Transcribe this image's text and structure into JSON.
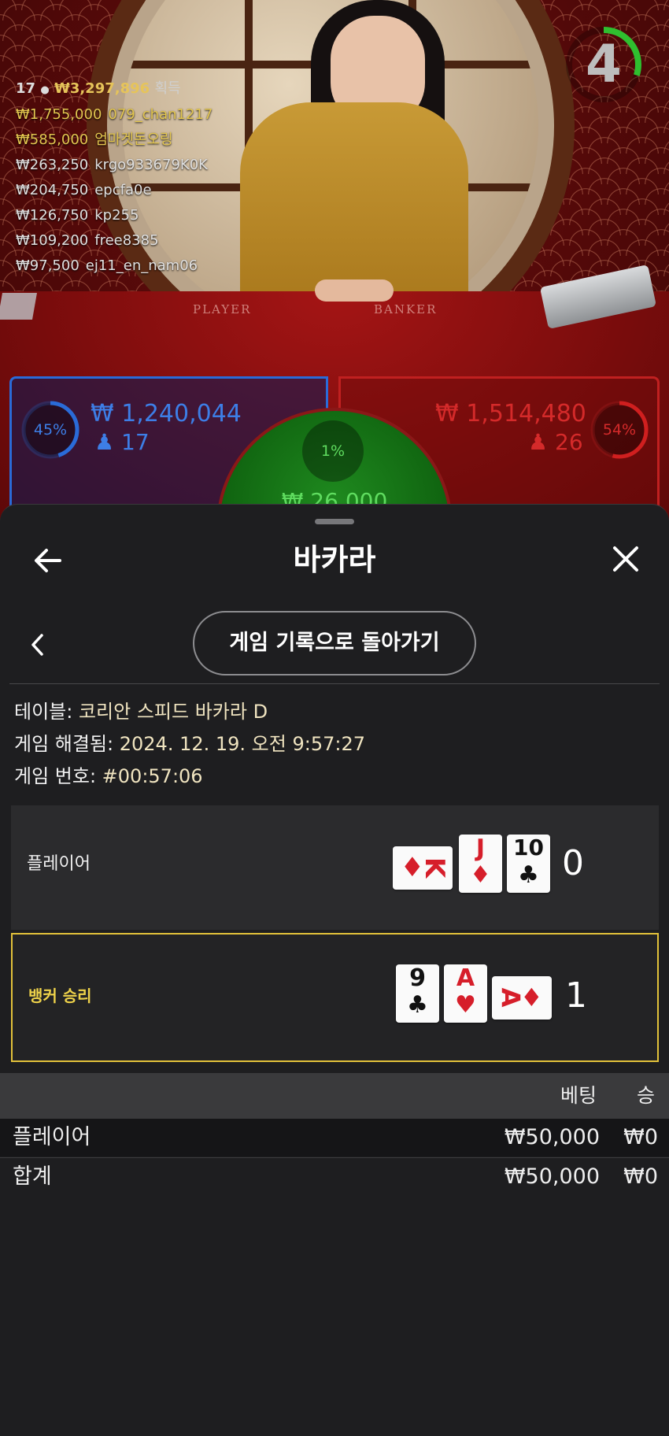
{
  "live": {
    "table_labels": {
      "player": "PLAYER",
      "banker": "BANKER"
    },
    "winners_header": {
      "count": "17",
      "total": "₩3,297,896",
      "label": "획득"
    },
    "winners": [
      {
        "amount": "₩1,755,000",
        "name": "079_chan1217"
      },
      {
        "amount": "₩585,000",
        "name": "엄마겟돈오링"
      },
      {
        "amount": "₩263,250",
        "name": "krgo933679K0K"
      },
      {
        "amount": "₩204,750",
        "name": "epcfa0e"
      },
      {
        "amount": "₩126,750",
        "name": "kp255"
      },
      {
        "amount": "₩109,200",
        "name": "free8385"
      },
      {
        "amount": "₩97,500",
        "name": "ej11_en_nam06"
      }
    ],
    "timer": {
      "value": "4",
      "fraction": 0.3
    },
    "player_bets": {
      "percent_label": "45%",
      "percent": 45,
      "pool": "₩ 1,240,044",
      "count": "17"
    },
    "banker_bets": {
      "percent_label": "54%",
      "percent": 54,
      "pool": "₩ 1,514,480",
      "count": "26"
    },
    "tie_bets": {
      "percent_label": "1%",
      "pool": "₩ 26,000"
    },
    "colors": {
      "player": "#2a6bd8",
      "banker": "#d01f1f",
      "tie": "#2fbf2f",
      "gold": "#e3c64f"
    }
  },
  "sheet": {
    "title": "바카라",
    "back_icon": "arrow-left-icon",
    "close_icon": "close-icon",
    "back_to_history": "게임 기록으로 돌아가기",
    "meta": {
      "table_label": "테이블: ",
      "table_value": "코리안 스피드 바카라 D",
      "resolved_label": "게임 해결됨: ",
      "resolved_value": "2024. 12. 19. 오전 9:57:27",
      "number_label": "게임 번호: ",
      "number_value": "#00:57:06"
    },
    "hands": {
      "player": {
        "label": "플레이어",
        "score": "0",
        "cards": [
          {
            "rank": "K",
            "suit": "♦",
            "color": "red",
            "rotated": true
          },
          {
            "rank": "J",
            "suit": "♦",
            "color": "red",
            "rotated": false
          },
          {
            "rank": "10",
            "suit": "♣",
            "color": "black",
            "rotated": false
          }
        ]
      },
      "banker": {
        "label": "뱅커 승리",
        "score": "1",
        "cards": [
          {
            "rank": "9",
            "suit": "♣",
            "color": "black",
            "rotated": false
          },
          {
            "rank": "A",
            "suit": "♥",
            "color": "red",
            "rotated": false
          },
          {
            "rank": "A",
            "suit": "♦",
            "color": "red",
            "rotated": true
          }
        ]
      }
    },
    "bets_table": {
      "headers": {
        "bet": "베팅",
        "win": "승"
      },
      "rows": [
        {
          "name": "플레이어",
          "bet": "₩50,000",
          "win": "₩0"
        },
        {
          "name": "합계",
          "bet": "₩50,000",
          "win": "₩0"
        }
      ]
    }
  }
}
